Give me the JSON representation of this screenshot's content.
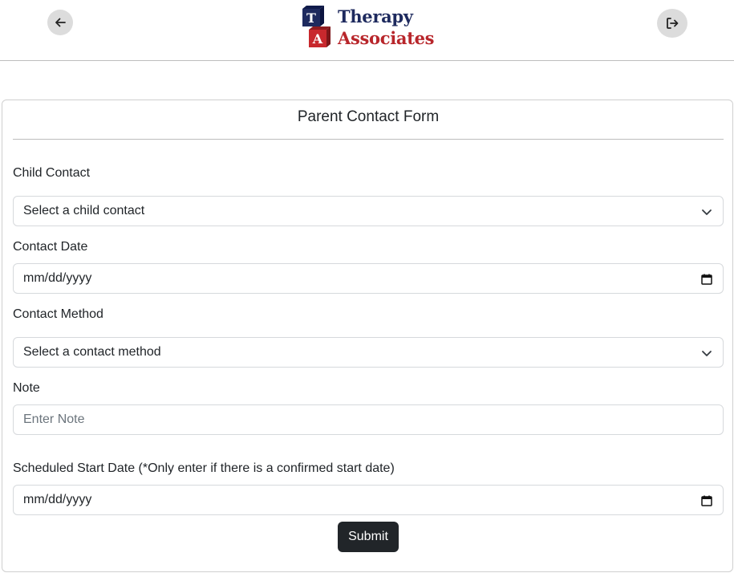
{
  "header": {
    "back_icon": "arrow-left-icon",
    "logout_icon": "logout-icon",
    "logo": {
      "block_letter_top": "T",
      "block_letter_bottom": "A",
      "line1": "Therapy",
      "line2": "Associates",
      "color_navy": "#1e2a5e",
      "color_red": "#b8262b"
    }
  },
  "form": {
    "title": "Parent Contact Form",
    "child_contact": {
      "label": "Child Contact",
      "value": "Select a child contact"
    },
    "contact_date": {
      "label": "Contact Date",
      "value": "mm/dd/yyyy"
    },
    "contact_method": {
      "label": "Contact Method",
      "value": "Select a contact method"
    },
    "note": {
      "label": "Note",
      "placeholder": "Enter Note"
    },
    "scheduled_start": {
      "label": "Scheduled Start Date (*Only enter if there is a confirmed start date)",
      "value": "mm/dd/yyyy"
    },
    "submit_label": "Submit",
    "colors": {
      "button": "#212529",
      "border": "#d6d9dc"
    }
  }
}
